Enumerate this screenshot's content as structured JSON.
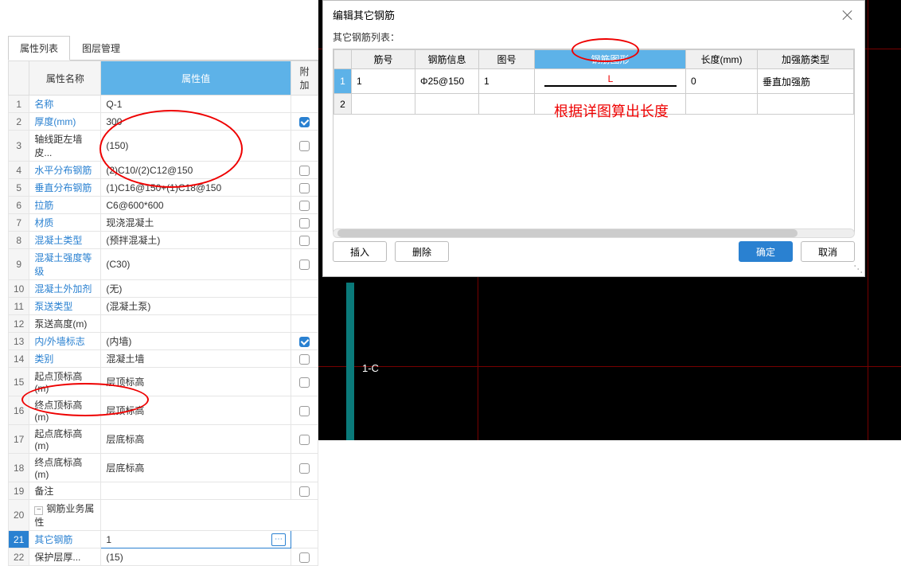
{
  "left": {
    "tabs": {
      "properties": "属性列表",
      "layers": "图层管理"
    },
    "head": {
      "name": "属性名称",
      "value": "属性值",
      "extra": "附加"
    },
    "rows": [
      {
        "i": "1",
        "name": "名称",
        "link": true,
        "val": "Q-1",
        "chk": null
      },
      {
        "i": "2",
        "name": "厚度(mm)",
        "link": true,
        "val": "300",
        "chk": true
      },
      {
        "i": "3",
        "name": "轴线距左墙皮...",
        "link": false,
        "val": "(150)",
        "chk": false
      },
      {
        "i": "4",
        "name": "水平分布钢筋",
        "link": true,
        "val": "(2)C10/(2)C12@150",
        "chk": false
      },
      {
        "i": "5",
        "name": "垂直分布钢筋",
        "link": true,
        "val": "(1)C16@150+(1)C18@150",
        "chk": false
      },
      {
        "i": "6",
        "name": "拉筋",
        "link": true,
        "val": "C6@600*600",
        "chk": false
      },
      {
        "i": "7",
        "name": "材质",
        "link": true,
        "val": "现浇混凝土",
        "chk": false
      },
      {
        "i": "8",
        "name": "混凝土类型",
        "link": true,
        "val": "(预拌混凝土)",
        "chk": false
      },
      {
        "i": "9",
        "name": "混凝土强度等级",
        "link": true,
        "val": "(C30)",
        "chk": false
      },
      {
        "i": "10",
        "name": "混凝土外加剂",
        "link": true,
        "val": "(无)",
        "chk": null
      },
      {
        "i": "11",
        "name": "泵送类型",
        "link": true,
        "val": "(混凝土泵)",
        "chk": null
      },
      {
        "i": "12",
        "name": "泵送高度(m)",
        "link": false,
        "val": "",
        "chk": null
      },
      {
        "i": "13",
        "name": "内/外墙标志",
        "link": true,
        "val": "(内墙)",
        "chk": true
      },
      {
        "i": "14",
        "name": "类别",
        "link": true,
        "val": "混凝土墙",
        "chk": false
      },
      {
        "i": "15",
        "name": "起点顶标高(m)",
        "link": false,
        "val": "层顶标高",
        "chk": false
      },
      {
        "i": "16",
        "name": "终点顶标高(m)",
        "link": false,
        "val": "层顶标高",
        "chk": false
      },
      {
        "i": "17",
        "name": "起点底标高(m)",
        "link": false,
        "val": "层底标高",
        "chk": false
      },
      {
        "i": "18",
        "name": "终点底标高(m)",
        "link": false,
        "val": "层底标高",
        "chk": false
      },
      {
        "i": "19",
        "name": "备注",
        "link": false,
        "val": "",
        "chk": false
      },
      {
        "i": "20",
        "name": "钢筋业务属性",
        "link": false,
        "val": "",
        "chk": null,
        "group": true
      },
      {
        "i": "21",
        "name": "其它钢筋",
        "link": true,
        "val": "1",
        "chk": null,
        "indent": true,
        "selected": true,
        "editable": true
      },
      {
        "i": "22",
        "name": "保护层厚...",
        "link": false,
        "val": "(15)",
        "chk": false,
        "indent": true
      }
    ]
  },
  "canvas": {
    "label": "1-C"
  },
  "dialog": {
    "title": "编辑其它钢筋",
    "subtitle": "其它钢筋列表：",
    "head": {
      "c0": "",
      "c1": "筋号",
      "c2": "钢筋信息",
      "c3": "图号",
      "c4": "钢筋图形",
      "c5": "长度(mm)",
      "c6": "加强筋类型"
    },
    "rows": [
      {
        "i": "1",
        "num": "1",
        "info": "Φ25@150",
        "fig": "1",
        "shapeLabel": "L",
        "len": "0",
        "type": "垂直加强筋"
      },
      {
        "i": "2",
        "num": "",
        "info": "",
        "fig": "",
        "shapeLabel": "",
        "len": "",
        "type": ""
      }
    ],
    "buttons": {
      "insert": "插入",
      "delete": "删除",
      "ok": "确定",
      "cancel": "取消"
    }
  },
  "annotation": {
    "text": "根据详图算出长度"
  }
}
